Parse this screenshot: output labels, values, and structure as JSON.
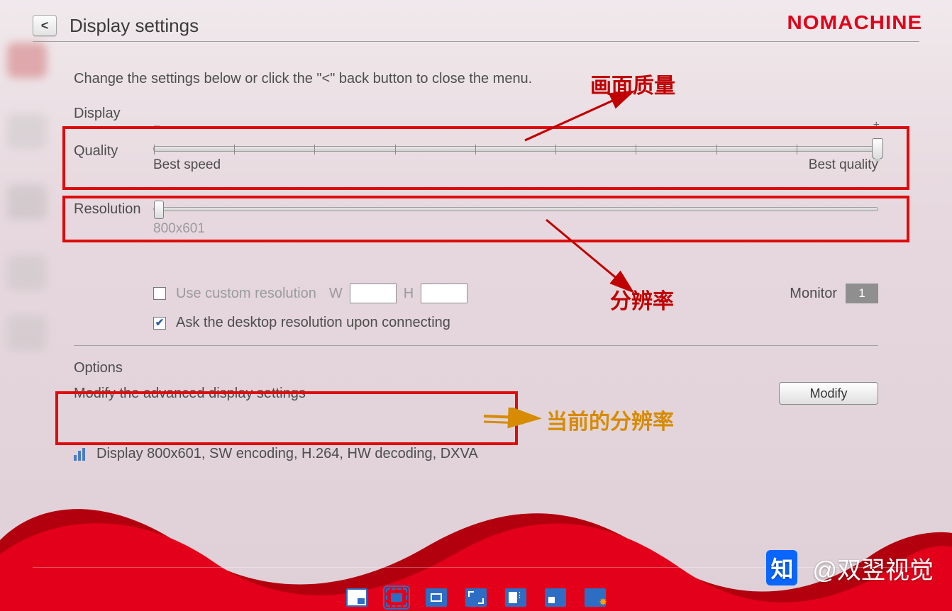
{
  "header": {
    "title": "Display settings",
    "back_glyph": "<",
    "brand": "NOMACHINE"
  },
  "intro": "Change the settings below or click the \"<\" back button to close the menu.",
  "display": {
    "section_label": "Display",
    "quality": {
      "label": "Quality",
      "left_label": "Best speed",
      "right_label": "Best quality",
      "ticks": 10,
      "value_percent": 100
    },
    "resolution": {
      "label": "Resolution",
      "value_text": "800x601",
      "value_percent": 0
    },
    "custom": {
      "checkbox_label": "Use custom resolution",
      "checked": false,
      "w_label": "W",
      "h_label": "H",
      "w_value": "",
      "h_value": ""
    },
    "monitor": {
      "label": "Monitor",
      "value": "1"
    },
    "ask": {
      "checked": true,
      "label": "Ask the desktop resolution upon connecting"
    }
  },
  "options": {
    "section_label": "Options",
    "text": "Modify the advanced display settings",
    "modify_label": "Modify"
  },
  "status": {
    "text": "Display 800x601, SW encoding, H.264, HW decoding, DXVA"
  },
  "annotations": {
    "quality": "画面质量",
    "resolution": "分辨率",
    "current": "当前的分辨率"
  },
  "toolbar_icons": [
    "viewport-icon",
    "fit-screen-icon",
    "fullscreen-icon",
    "expand-icon",
    "resize-icon",
    "scale-icon",
    "display-settings-icon"
  ],
  "watermark": {
    "logo": "知",
    "text": "@双翌视觉"
  }
}
